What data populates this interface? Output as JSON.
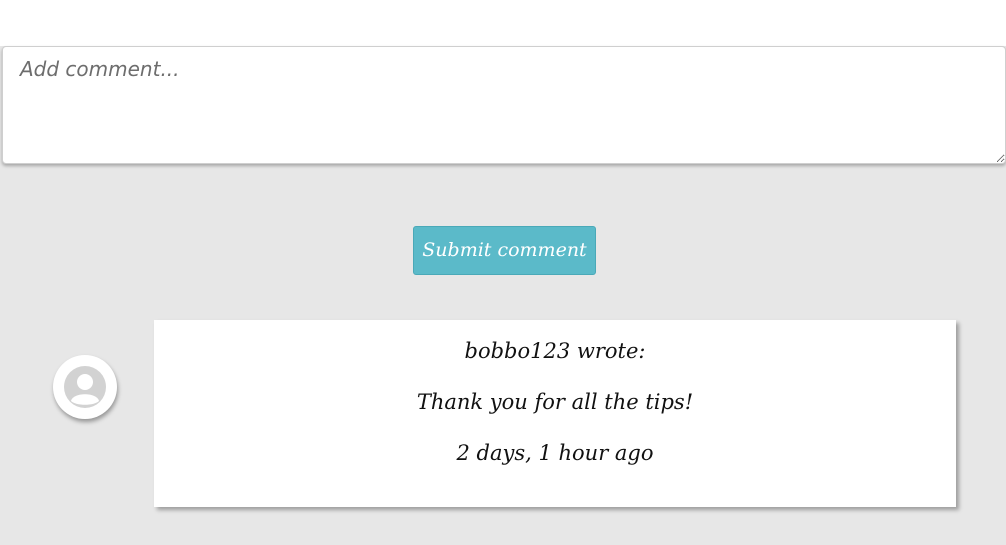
{
  "comment_form": {
    "placeholder": "Add comment...",
    "submit_label": "Submit comment"
  },
  "comments": [
    {
      "author_line": "bobbo123 wrote:",
      "text": "Thank you for all the tips!",
      "time": "2 days, 1 hour ago",
      "avatar_icon": "user-placeholder-icon"
    }
  ],
  "colors": {
    "page_background": "#e7e7e7",
    "button_background": "#5bbac9",
    "card_background": "#ffffff"
  }
}
